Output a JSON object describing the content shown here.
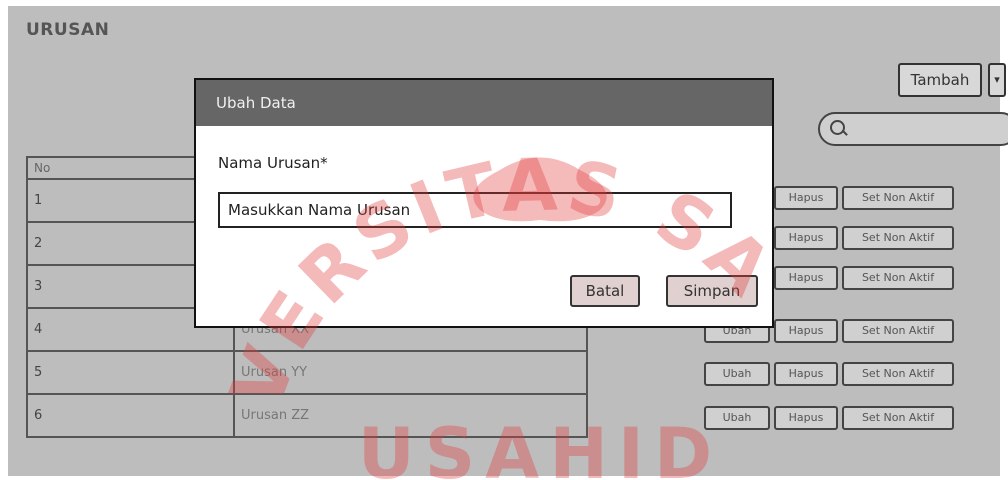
{
  "page": {
    "title": "URUSAN"
  },
  "toolbar": {
    "add_label": "Tambah",
    "add_dropdown_glyph": "▾"
  },
  "search": {
    "placeholder": ""
  },
  "table": {
    "header_no": "No",
    "rows": [
      {
        "no": "1",
        "nama": ""
      },
      {
        "no": "2",
        "nama": ""
      },
      {
        "no": "3",
        "nama": ""
      },
      {
        "no": "4",
        "nama": "Urusan XX"
      },
      {
        "no": "5",
        "nama": "Urusan YY"
      },
      {
        "no": "6",
        "nama": "Urusan ZZ"
      }
    ],
    "action_labels": {
      "ubah": "Ubah",
      "hapus": "Hapus",
      "set_non_aktif": "Set Non Aktif"
    }
  },
  "modal": {
    "title": "Ubah Data",
    "field_label": "Nama Urusan*",
    "field_value": "Masukkan Nama Urusan",
    "cancel_label": "Batal",
    "save_label": "Simpan"
  },
  "watermark": {
    "text": "VERSITAS SA",
    "lower_text": "USAHID",
    "color": "#e23a3a"
  }
}
